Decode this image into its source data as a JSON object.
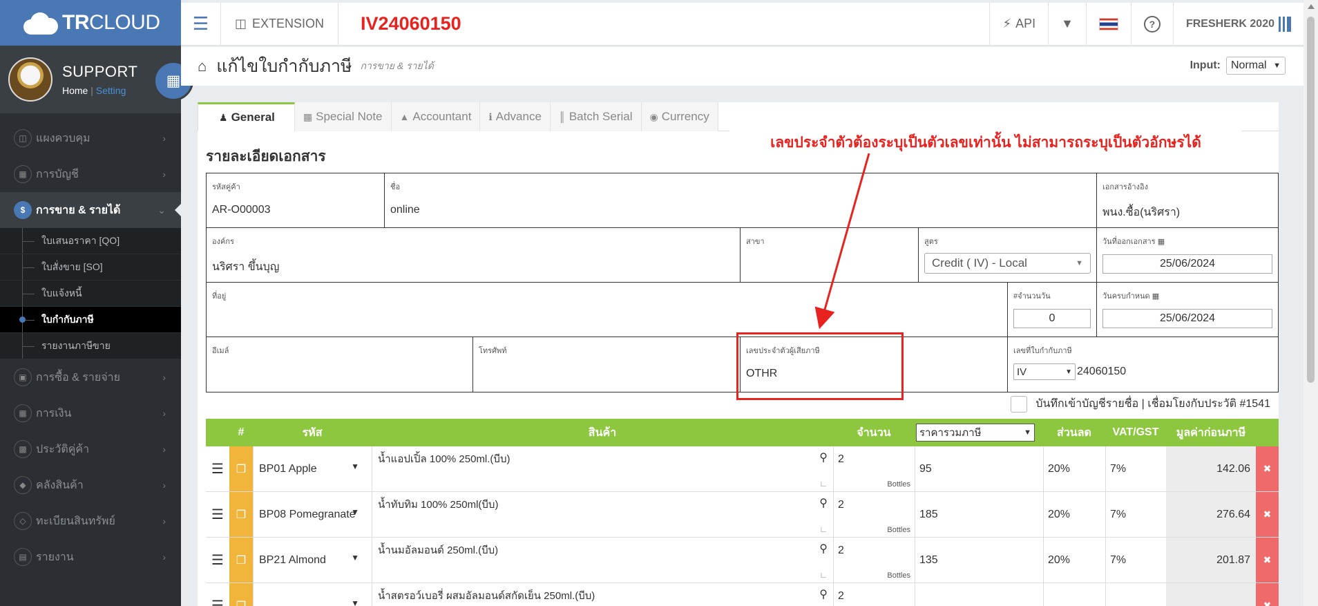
{
  "app": {
    "logo_bold": "TR",
    "logo_light": "CLOUD",
    "document_number": "IV24060150"
  },
  "profile": {
    "name": "SUPPORT",
    "home_link": "Home",
    "setting_link": "Setting"
  },
  "sidebar": {
    "items": [
      {
        "label": "แผงควบคุม",
        "icon": "monitor-icon"
      },
      {
        "label": "การบัญชี",
        "icon": "book-icon"
      },
      {
        "label": "การขาย & รายได้",
        "icon": "dollar-icon",
        "active": true
      },
      {
        "label": "การซื้อ & รายจ่าย",
        "icon": "cart-icon"
      },
      {
        "label": "การเงิน",
        "icon": "calendar-icon"
      },
      {
        "label": "ประวัติคู่ค้า",
        "icon": "contact-icon"
      },
      {
        "label": "คลังสินค้า",
        "icon": "boxes-icon"
      },
      {
        "label": "ทะเบียนสินทรัพย์",
        "icon": "diamond-icon"
      },
      {
        "label": "รายงาน",
        "icon": "report-icon"
      }
    ],
    "sub_items": [
      {
        "label": "ใบเสนอราคา [QO]"
      },
      {
        "label": "ใบสั่งขาย [SO]"
      },
      {
        "label": "ใบแจ้งหนี้"
      },
      {
        "label": "ใบกำกับภาษี",
        "current": true
      },
      {
        "label": "รายงานภาษีขาย"
      }
    ]
  },
  "topbar": {
    "extension_label": "EXTENSION",
    "api_label": "API",
    "company_label": "FRESHERK 2020"
  },
  "page": {
    "title": "แก้ไขใบกำกับภาษี",
    "subtitle": "การขาย & รายได้",
    "input_label": "Input:",
    "input_mode": "Normal"
  },
  "tabs": [
    {
      "label": "General",
      "icon": "user-icon",
      "active": true
    },
    {
      "label": "Special Note",
      "icon": "note-icon"
    },
    {
      "label": "Accountant",
      "icon": "graduation-icon"
    },
    {
      "label": "Advance",
      "icon": "info-icon"
    },
    {
      "label": "Batch Serial",
      "icon": "barcode-icon"
    },
    {
      "label": "Currency",
      "icon": "globe-icon"
    }
  ],
  "section_title": "รายละเอียดเอกสาร",
  "form": {
    "customer_code_label": "รหัสคู่ค้า",
    "customer_code": "AR-O00003",
    "name_label": "ชื่อ",
    "name": "online",
    "ref_doc_label": "เอกสารอ้างอิง",
    "ref_doc": "พนง.ซื้อ(นริศรา)",
    "org_label": "องค์กร",
    "org": "นริศรา ขึ้นบุญ",
    "branch_label": "สาขา",
    "branch": "",
    "formula_label": "สูตร",
    "formula": "Credit ( IV) - Local",
    "issue_date_label": "วันที่ออกเอกสาร",
    "issue_date": "25/06/2024",
    "address_label": "ที่อยู่",
    "days_label": "#จำนวนวัน",
    "days": "0",
    "due_date_label": "วันครบกำหนด",
    "due_date": "25/06/2024",
    "email_label": "อีเมล์",
    "phone_label": "โทรศัพท์",
    "taxid_label": "เลขประจำตัวผู้เสียภาษี",
    "taxid": "OTHR",
    "taxinv_label": "เลขที่ใบกำกับภาษี",
    "taxinv_prefix": "IV",
    "taxinv_number": "24060150"
  },
  "record_note": "บันทึกเข้าบัญชีรายชื่อ | เชื่อมโยงกับประวัติ #1541",
  "table": {
    "headers": {
      "num": "#",
      "code": "รหัส",
      "product": "สินค้า",
      "qty": "จำนวน",
      "price_mode": "ราคารวมภาษี",
      "discount": "ส่วนลด",
      "vat": "VAT/GST",
      "amount": "มูลค่าก่อนภาษี"
    },
    "rows": [
      {
        "code": "BP01 Apple",
        "name": "น้ำแอปเปิ้ล 100% 250ml.(บีบ)",
        "qty": "2",
        "unit": "Bottles",
        "price": "95",
        "discount": "20%",
        "vat": "7%",
        "amount": "142.06"
      },
      {
        "code": "BP08 Pomegranate",
        "name": "น้ำทับทิม 100% 250ml(บีบ)",
        "qty": "2",
        "unit": "Bottles",
        "price": "185",
        "discount": "20%",
        "vat": "7%",
        "amount": "276.64"
      },
      {
        "code": "BP21 Almond",
        "name": "น้ำนมอัลมอนด์ 250ml.(บีบ)",
        "qty": "2",
        "unit": "Bottles",
        "price": "135",
        "discount": "20%",
        "vat": "7%",
        "amount": "201.87"
      },
      {
        "code": "",
        "name": "น้ำสตรอว์เบอรี่ ผสมอัลมอนด์สกัดเย็น  250ml.(บีบ)",
        "qty": "2",
        "unit": "",
        "price": "",
        "discount": "",
        "vat": "",
        "amount": ""
      }
    ]
  },
  "annotation": {
    "callout_text": "เลขประจำตัวต้องระบุเป็นตัวเลขเท่านั้น ไม่สามารถระบุเป็นตัวอักษรได้",
    "color": "#e8221e"
  },
  "colors": {
    "brand": "#4a78b4",
    "sidebar": "#2b2f33",
    "table_header": "#8dc63f",
    "copy_button": "#f0b53a",
    "delete_button": "#ef6a6a"
  }
}
